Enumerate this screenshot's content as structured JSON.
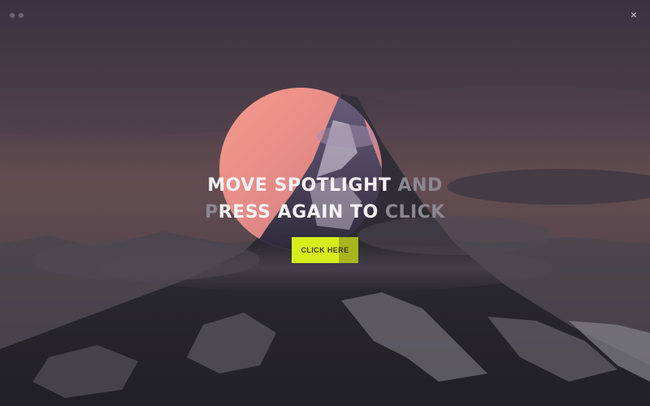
{
  "window": {
    "controls": [
      "window-dot",
      "window-dot"
    ],
    "close_label": "×",
    "close_icon": "close-icon"
  },
  "spotlight": {
    "icon": "spotlight-circle",
    "tint": "#f08a80"
  },
  "headline": {
    "line1_lit": "MOVE SPOTLIGHT",
    "line1_dim": " AND",
    "line2_dim": "P",
    "line2_lit": "RESS AGAIN TO",
    "line2_dim_end": " CLICK"
  },
  "cta": {
    "label": "CLICK HERE",
    "color": "#d6ee1e"
  },
  "colors": {
    "sky_top": "#3f3a47",
    "sky_mid": "#6e555a",
    "sky_glow": "#8a6565",
    "mountain": "#2f2d34",
    "snow": "#b9b7bd"
  }
}
